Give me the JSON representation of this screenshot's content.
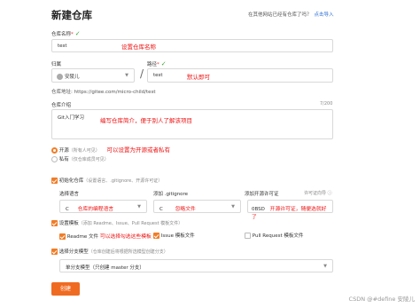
{
  "page": {
    "title": "新建仓库",
    "hint_text": "在其他网站已经有仓库了吗？",
    "hint_link": "点击导入"
  },
  "repo_name": {
    "label": "仓库名称",
    "value": "test",
    "annotation": "设置仓库名称"
  },
  "owner": {
    "label": "归属",
    "value": "安陵儿"
  },
  "path": {
    "label": "路径",
    "value": "test",
    "annotation": "默认即可"
  },
  "repo_url": {
    "label": "仓库地址:",
    "value": "https://gitee.com/micro-child/test"
  },
  "intro": {
    "label": "仓库介绍",
    "counter": "7/200",
    "value": "Git入门学习",
    "annotation": "编写仓库简介，便于别人了解该项目"
  },
  "visibility": {
    "open_label": "开源",
    "open_desc": "（所有人可见）",
    "open_annotation": "可以设置为开源或者私有",
    "private_label": "私有",
    "private_desc": "（仅仓库成员可见）"
  },
  "init": {
    "label": "初始化仓库",
    "desc": "（设置语言、.gitignore、开源许可证）",
    "lang_label": "选择语言",
    "lang_value": "C",
    "lang_annotation": "仓库的编程语言",
    "gitignore_label": "添加 .gitignore",
    "gitignore_value": "C",
    "gitignore_annotation": "忽略文件",
    "license_label": "添加开源许可证",
    "license_help": "许可证向导",
    "license_value": "0BSD",
    "license_annotation": "开源许可证，随便选就好了"
  },
  "template": {
    "label": "设置模板",
    "desc": "（添加 Readme、Issue、Pull Request 模板文件）",
    "readme_label": "Readme 文件",
    "readme_annotation": "可以选择勾选这些模板",
    "issue_label": "Issue 模板文件",
    "pr_label": "Pull Request 模板文件"
  },
  "branch": {
    "label": "选择分支模型",
    "desc": "（仓库创建后将根据所选模型创建分支）",
    "value": "单分支模型（只创建 master 分支）"
  },
  "create_button": "创建",
  "footer": "CSDN @#define 安陵儿",
  "colors": {
    "accent": "#f07d28",
    "annotation_red": "#ee1111",
    "link_blue": "#2b6fd6",
    "check_green": "#33aa33"
  }
}
